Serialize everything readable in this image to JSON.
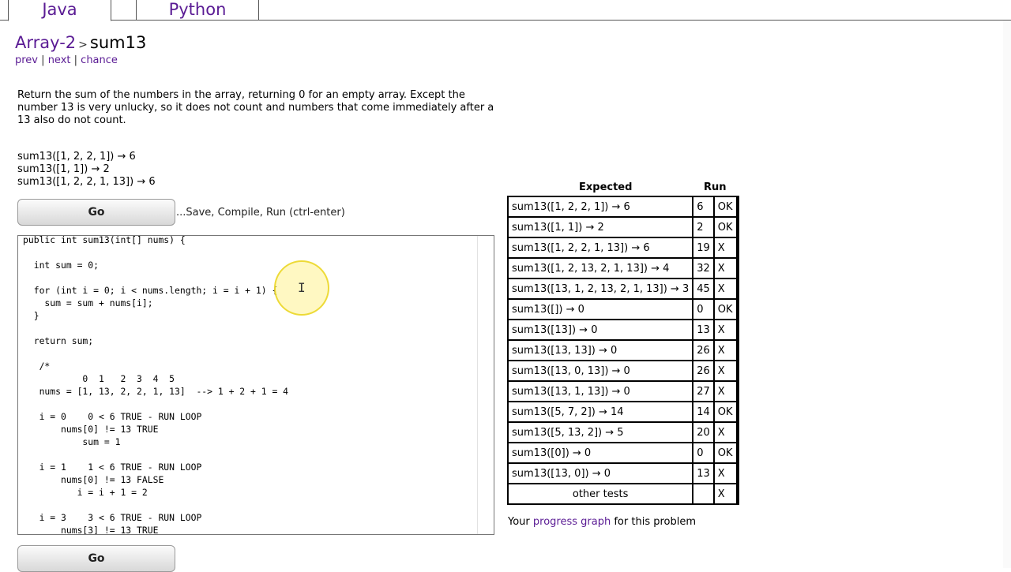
{
  "tabs": [
    {
      "label": "Java"
    },
    {
      "label": "Python"
    }
  ],
  "breadcrumb": {
    "parent": "Array-2",
    "separator": ">",
    "current": "sum13"
  },
  "nav": {
    "prev": "prev",
    "next": "next",
    "chance": "chance",
    "divider": "|"
  },
  "description": "Return the sum of the numbers in the array, returning 0 for an empty array. Except the number 13 is very unlucky, so it does not count and numbers that come immediately after a 13 also do not count.",
  "examples": [
    "sum13([1, 2, 2, 1]) → 6",
    "sum13([1, 1]) → 2",
    "sum13([1, 2, 2, 1, 13]) → 6"
  ],
  "go_button": {
    "label": "Go",
    "hint": "...Save, Compile, Run (ctrl-enter)"
  },
  "editor": {
    "code": "public int sum13(int[] nums) {\n\n  int sum = 0;\n\n  for (int i = 0; i < nums.length; i = i + 1) {\n    sum = sum + nums[i];\n  }\n\n  return sum;\n\n   /*\n           0  1   2  3  4  5\n   nums = [1, 13, 2, 2, 1, 13]  --> 1 + 2 + 1 = 4\n\n   i = 0    0 < 6 TRUE - RUN LOOP\n       nums[0] != 13 TRUE\n           sum = 1\n\n   i = 1    1 < 6 TRUE - RUN LOOP\n       nums[0] != 13 FALSE\n          i = i + 1 = 2\n\n   i = 3    3 < 6 TRUE - RUN LOOP\n       nums[3] != 13 TRUE"
  },
  "results": {
    "header_expected": "Expected",
    "header_run": "Run",
    "rows": [
      {
        "expected": "sum13([1, 2, 2, 1]) → 6",
        "run": "6",
        "status": "OK",
        "color": "#008a00"
      },
      {
        "expected": "sum13([1, 1]) → 2",
        "run": "2",
        "status": "OK",
        "color": "#008a00"
      },
      {
        "expected": "sum13([1, 2, 2, 1, 13]) → 6",
        "run": "19",
        "status": "X",
        "color": "#ff0000"
      },
      {
        "expected": "sum13([1, 2, 13, 2, 1, 13]) → 4",
        "run": "32",
        "status": "X",
        "color": "#ff0000"
      },
      {
        "expected": "sum13([13, 1, 2, 13, 2, 1, 13]) → 3",
        "run": "45",
        "status": "X",
        "color": "#ff0000"
      },
      {
        "expected": "sum13([]) → 0",
        "run": "0",
        "status": "OK",
        "color": "#008a00"
      },
      {
        "expected": "sum13([13]) → 0",
        "run": "13",
        "status": "X",
        "color": "#ff0000"
      },
      {
        "expected": "sum13([13, 13]) → 0",
        "run": "26",
        "status": "X",
        "color": "#ff0000"
      },
      {
        "expected": "sum13([13, 0, 13]) → 0",
        "run": "26",
        "status": "X",
        "color": "#ff0000"
      },
      {
        "expected": "sum13([13, 1, 13]) → 0",
        "run": "27",
        "status": "X",
        "color": "#ff0000"
      },
      {
        "expected": "sum13([5, 7, 2]) → 14",
        "run": "14",
        "status": "OK",
        "color": "#008a00"
      },
      {
        "expected": "sum13([5, 13, 2]) → 5",
        "run": "20",
        "status": "X",
        "color": "#ff0000"
      },
      {
        "expected": "sum13([0]) → 0",
        "run": "0",
        "status": "OK",
        "color": "#008a00"
      },
      {
        "expected": "sum13([13, 0]) → 0",
        "run": "13",
        "status": "X",
        "color": "#ff0000"
      }
    ],
    "other": {
      "label": "other tests",
      "run": "",
      "status": "X",
      "color": "#ff0000"
    }
  },
  "progress": {
    "prefix": "Your",
    "link": "progress graph",
    "suffix": "for this problem"
  }
}
